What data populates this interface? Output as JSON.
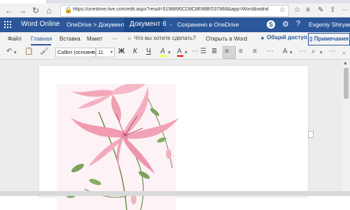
{
  "browser": {
    "url": "https://onedrive.live.com/edit.aspx?resid=5198896CD8C8E88B!537868&app=Word&wdnd=1&wdP",
    "nav_back": "←",
    "nav_forward": "→",
    "nav_reload": "↻",
    "nav_home": "⌂"
  },
  "header": {
    "app_name": "Word Online",
    "breadcrumb": "OneDrive > Документы",
    "doc_name": "Документ 6",
    "separator": "-",
    "save_status": "Сохранено в OneDrive",
    "user_name": "Evgeniy Shiryaev",
    "skype_glyph": "S",
    "gear_glyph": "⚙",
    "help_glyph": "?"
  },
  "ribbon": {
    "tabs": [
      "Файл",
      "Главная",
      "Вставка",
      "Макет"
    ],
    "more_glyph": "⋯",
    "tell_me": "Что вы хотите сделать?",
    "open_in_word": "Открыть в Word",
    "share": "Общий доступ",
    "comments": "Примечания"
  },
  "toolbar": {
    "font_name": "Calibri (основно",
    "font_size": "11",
    "bold": "Ж",
    "italic": "К",
    "underline": "Ч",
    "highlight_letter": "A",
    "font_color_letter": "A",
    "highlight_color": "#ffff00",
    "font_color": "#ff0000"
  },
  "colors": {
    "brand": "#2b579a",
    "header_bg": "#2b579a",
    "ribbon_bg": "#f3f3f3"
  }
}
